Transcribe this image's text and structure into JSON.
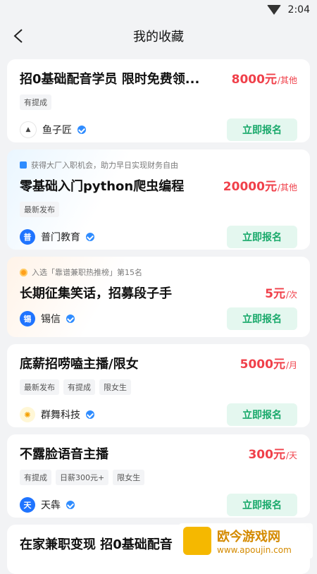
{
  "status": {
    "time": "2:04"
  },
  "nav": {
    "title": "我的收藏"
  },
  "cards": [
    {
      "title": "招0基础配音学员 限时免费领...",
      "salary": "8000元",
      "unit": "/其他",
      "tags": [
        "有提成"
      ],
      "company": "鱼子匠",
      "apply": "立即报名"
    },
    {
      "promo": "获得大厂入职机会，助力早日实现财务自由",
      "title": "零基础入门python爬虫编程",
      "salary": "20000元",
      "unit": "/其他",
      "tags": [
        "最新发布"
      ],
      "company_initial": "普",
      "company": "普门教育",
      "apply": "立即报名"
    },
    {
      "promo": "入选「靠谱兼职热推榜」第15名",
      "title": "长期征集笑话，招募段子手",
      "salary": "5元",
      "unit": "/次",
      "tags": [],
      "company_initial": "锡",
      "company": "锡信",
      "apply": "立即报名"
    },
    {
      "title": "底薪招唠嗑主播/限女",
      "salary": "5000元",
      "unit": "/月",
      "tags": [
        "最新发布",
        "有提成",
        "限女生"
      ],
      "company": "群舞科技",
      "apply": "立即报名"
    },
    {
      "title": "不露脸语音主播",
      "salary": "300元",
      "unit": "/天",
      "tags": [
        "有提成",
        "日薪300元+",
        "限女生"
      ],
      "company_initial": "天",
      "company": "天犇",
      "apply": "立即报名"
    },
    {
      "title": "在家兼职变现 招0基础配音",
      "tags": []
    }
  ],
  "watermark": {
    "title": "欧今游戏网",
    "url": "www.apoujin.com"
  }
}
